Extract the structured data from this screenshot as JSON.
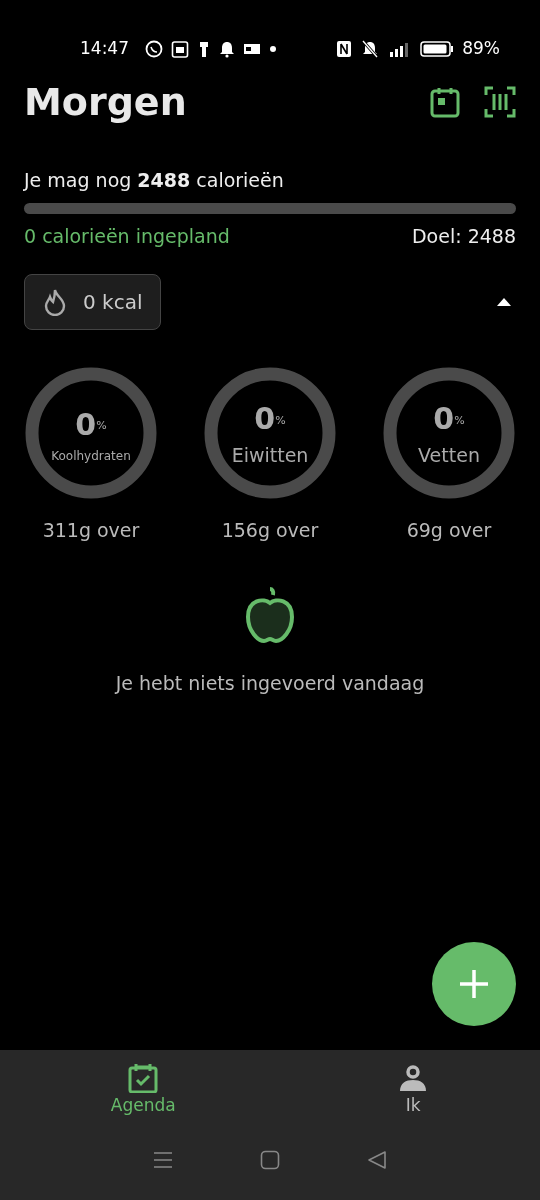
{
  "status_bar": {
    "time": "14:47",
    "battery": "89%"
  },
  "header": {
    "title": "Morgen"
  },
  "summary": {
    "remaining": "Je mag nog **2488** calorieën",
    "level": 0,
    "planned": "0 calorieën ingepland",
    "goal": "Doel: 2488"
  },
  "burned": {
    "label": "0 kcal",
    "expanded": true
  },
  "macros": [
    {
      "value": "0",
      "unit": "%",
      "name": "Koolhydraten",
      "remaining": "311g over",
      "small": true
    },
    {
      "value": "0",
      "unit": "%",
      "name": "Eiwitten",
      "remaining": "156g over",
      "small": false
    },
    {
      "value": "0",
      "unit": "%",
      "name": "Vetten",
      "remaining": "69g over",
      "small": false
    }
  ],
  "empty_state": {
    "message": "Je hebt niets ingevoerd vandaag"
  },
  "bottom_nav": [
    {
      "label": "Agenda",
      "kind": "agenda",
      "selected": true
    },
    {
      "label": "Ik",
      "kind": "profile",
      "selected": false
    }
  ]
}
